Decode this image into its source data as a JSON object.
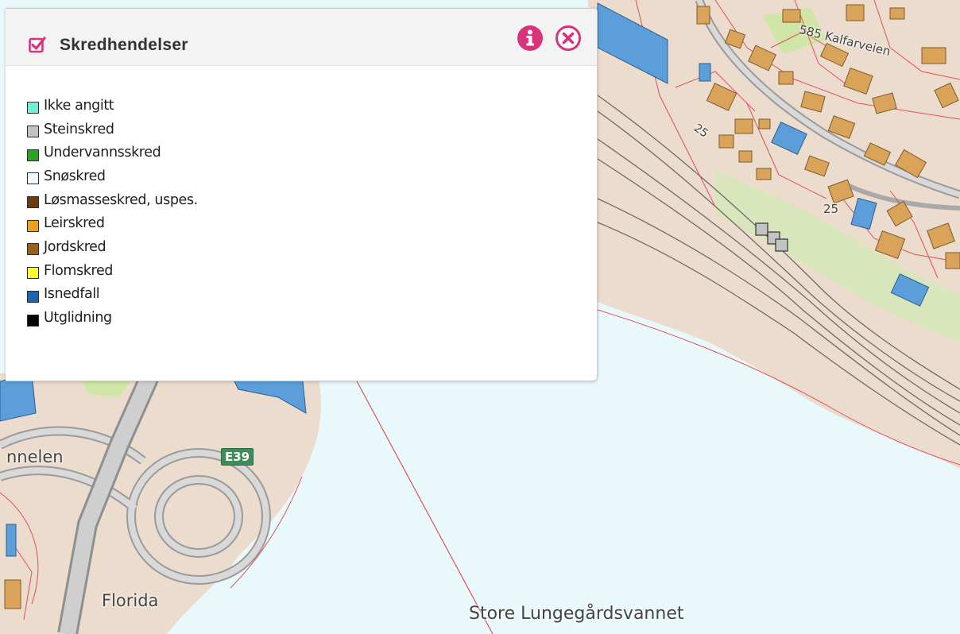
{
  "panel": {
    "title": "Skredhendelser",
    "checked": true,
    "accent_color": "#d8327a",
    "info_icon": "info-circle-icon",
    "close_icon": "close-circle-icon"
  },
  "legend": {
    "items": [
      {
        "label": "Ikke angitt",
        "color": "#6ff0d0"
      },
      {
        "label": "Steinskred",
        "color": "#c3c3c3"
      },
      {
        "label": "Undervannsskred",
        "color": "#26a61a"
      },
      {
        "label": "Snøskred",
        "color": "#eef8ff"
      },
      {
        "label": "Løsmasseskred, uspes.",
        "color": "#6a3d0f"
      },
      {
        "label": "Leirskred",
        "color": "#f0a11c"
      },
      {
        "label": "Jordskred",
        "color": "#9c6116"
      },
      {
        "label": "Flomskred",
        "color": "#ffff2e"
      },
      {
        "label": "Isnedfall",
        "color": "#1965b6"
      },
      {
        "label": "Utglidning",
        "color": "#060606"
      }
    ]
  },
  "map": {
    "labels": {
      "street": "585 Kalfarveien",
      "address_number_1": "25",
      "address_number_2": "25",
      "tunnel_fragment": "nnelen",
      "district": "Florida",
      "lake": "Store Lungegårdsvannet"
    },
    "road_shield": "E39",
    "colors": {
      "water": "#e9f9fb",
      "land": "#ecdccd",
      "building": "#d9a45a",
      "parcel_line": "#e0505a",
      "rail": "#6b6b6b"
    }
  }
}
